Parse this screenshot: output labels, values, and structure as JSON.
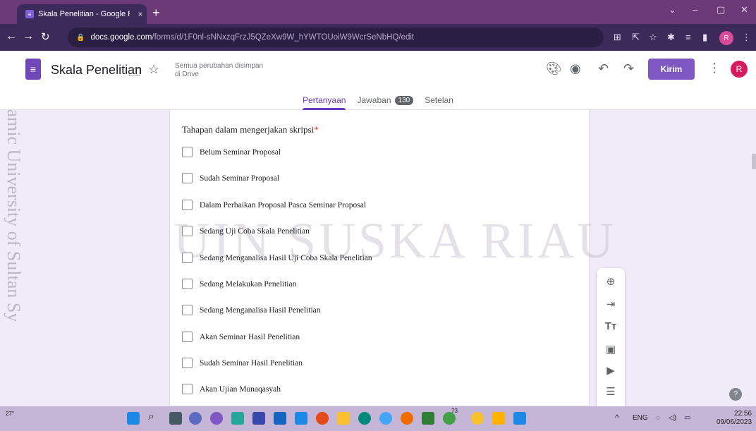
{
  "browser": {
    "tab_title": "Skala Penelitian - Google Formul",
    "tab_close": "×",
    "new_tab": "+",
    "url_host": "docs.google.com",
    "url_path": "/forms/d/1F0nl-sNNxzqFrzJ5QZeXw9W_hYWTOUoiW9WcrSeNbHQ/edit",
    "profile_letter": "R"
  },
  "header": {
    "title": "Skala Penelitian",
    "save_status_line1": "Semua perubahan disimpan",
    "save_status_line2": "di Drive",
    "send_label": "Kirim",
    "avatar_letter": "R"
  },
  "tabs": {
    "questions": "Pertanyaan",
    "responses": "Jawaban",
    "responses_count": "130",
    "settings": "Setelan"
  },
  "question": {
    "title": "Tahapan dalam mengerjakan skripsi",
    "required_marker": "*",
    "options": [
      "Belum Seminar Proposal",
      "Sudah Seminar Proposal",
      "Dalam Perbaikan Proposal Pasca Seminar Proposal",
      "Sedang Uji Coba Skala Penelitian",
      "Sedang Menganalisa Hasil Uji Coba Skala Penelitian",
      "Sedang Melakukan Penelitian",
      "Sedang Menganalisa Hasil Penelitian",
      "Akan Seminar Hasil Penelitian",
      "Sudah Seminar Hasil Penelitian",
      "Akan Ujian Munaqasyah"
    ]
  },
  "watermark": {
    "center": "UIN SUSKA RIAU",
    "side": "State Islamic University of Sultan Sy"
  },
  "taskbar": {
    "weather_temp": "27°",
    "language": "ENG",
    "time": "22:56",
    "date": "09/06/2023",
    "notif_count": "73"
  },
  "colors": {
    "accent": "#673ab7",
    "send_button": "#7e57c2",
    "required": "#d93025"
  }
}
